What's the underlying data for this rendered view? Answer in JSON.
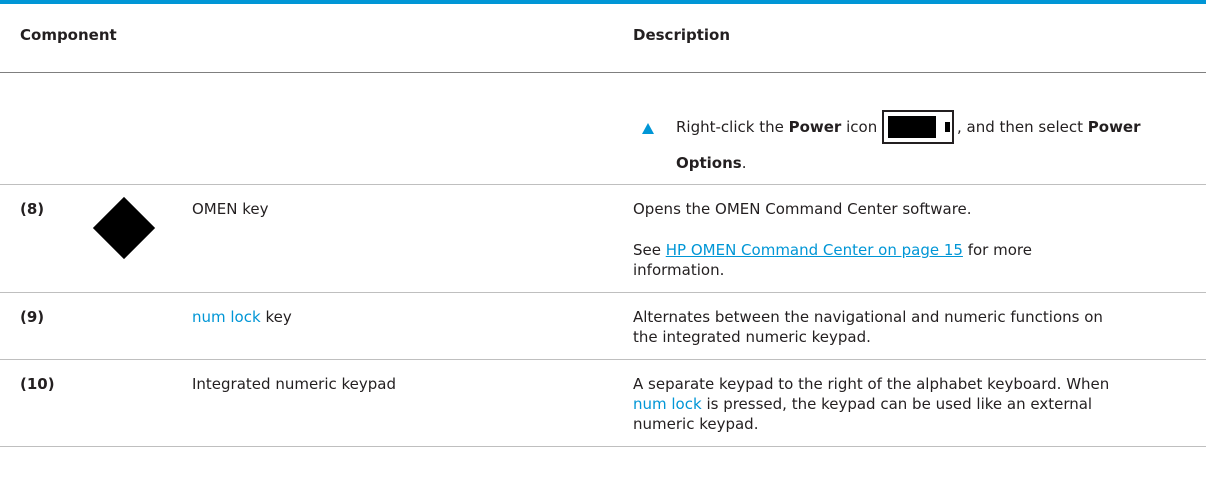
{
  "table": {
    "headers": {
      "component": "Component",
      "description": "Description"
    },
    "continuation": {
      "bullet_symbol": "triangle-bullet-icon",
      "text_1": "Right-click the ",
      "bold_1": "Power",
      "text_2": " icon ",
      "power_icon": "battery-icon",
      "text_3": ", and then select ",
      "bold_2": "Power",
      "bold_3": "Options",
      "text_4": "."
    },
    "rows": [
      {
        "number": "(8)",
        "icon": "omen-diamond-icon",
        "component": "OMEN key",
        "description_1": "Opens the OMEN Command Center software.",
        "description_2_prefix": "See ",
        "description_2_link": "HP OMEN Command Center on page 15",
        "description_2_suffix": " for more",
        "description_3": "information."
      },
      {
        "number": "(9)",
        "component_highlight": "num lock",
        "component_suffix": " key",
        "description_1": "Alternates between the navigational and numeric functions on",
        "description_2": "the integrated numeric keypad."
      },
      {
        "number": "(10)",
        "component": "Integrated numeric keypad",
        "description_1": "A separate keypad to the right of the alphabet keyboard. When",
        "description_2_highlight": "num lock",
        "description_2_suffix": " is pressed, the keypad can be used like an external",
        "description_3": "numeric keypad."
      }
    ]
  },
  "colors": {
    "accent": "#0096d6",
    "text": "#231f20",
    "rule": "#bfbfbf"
  }
}
